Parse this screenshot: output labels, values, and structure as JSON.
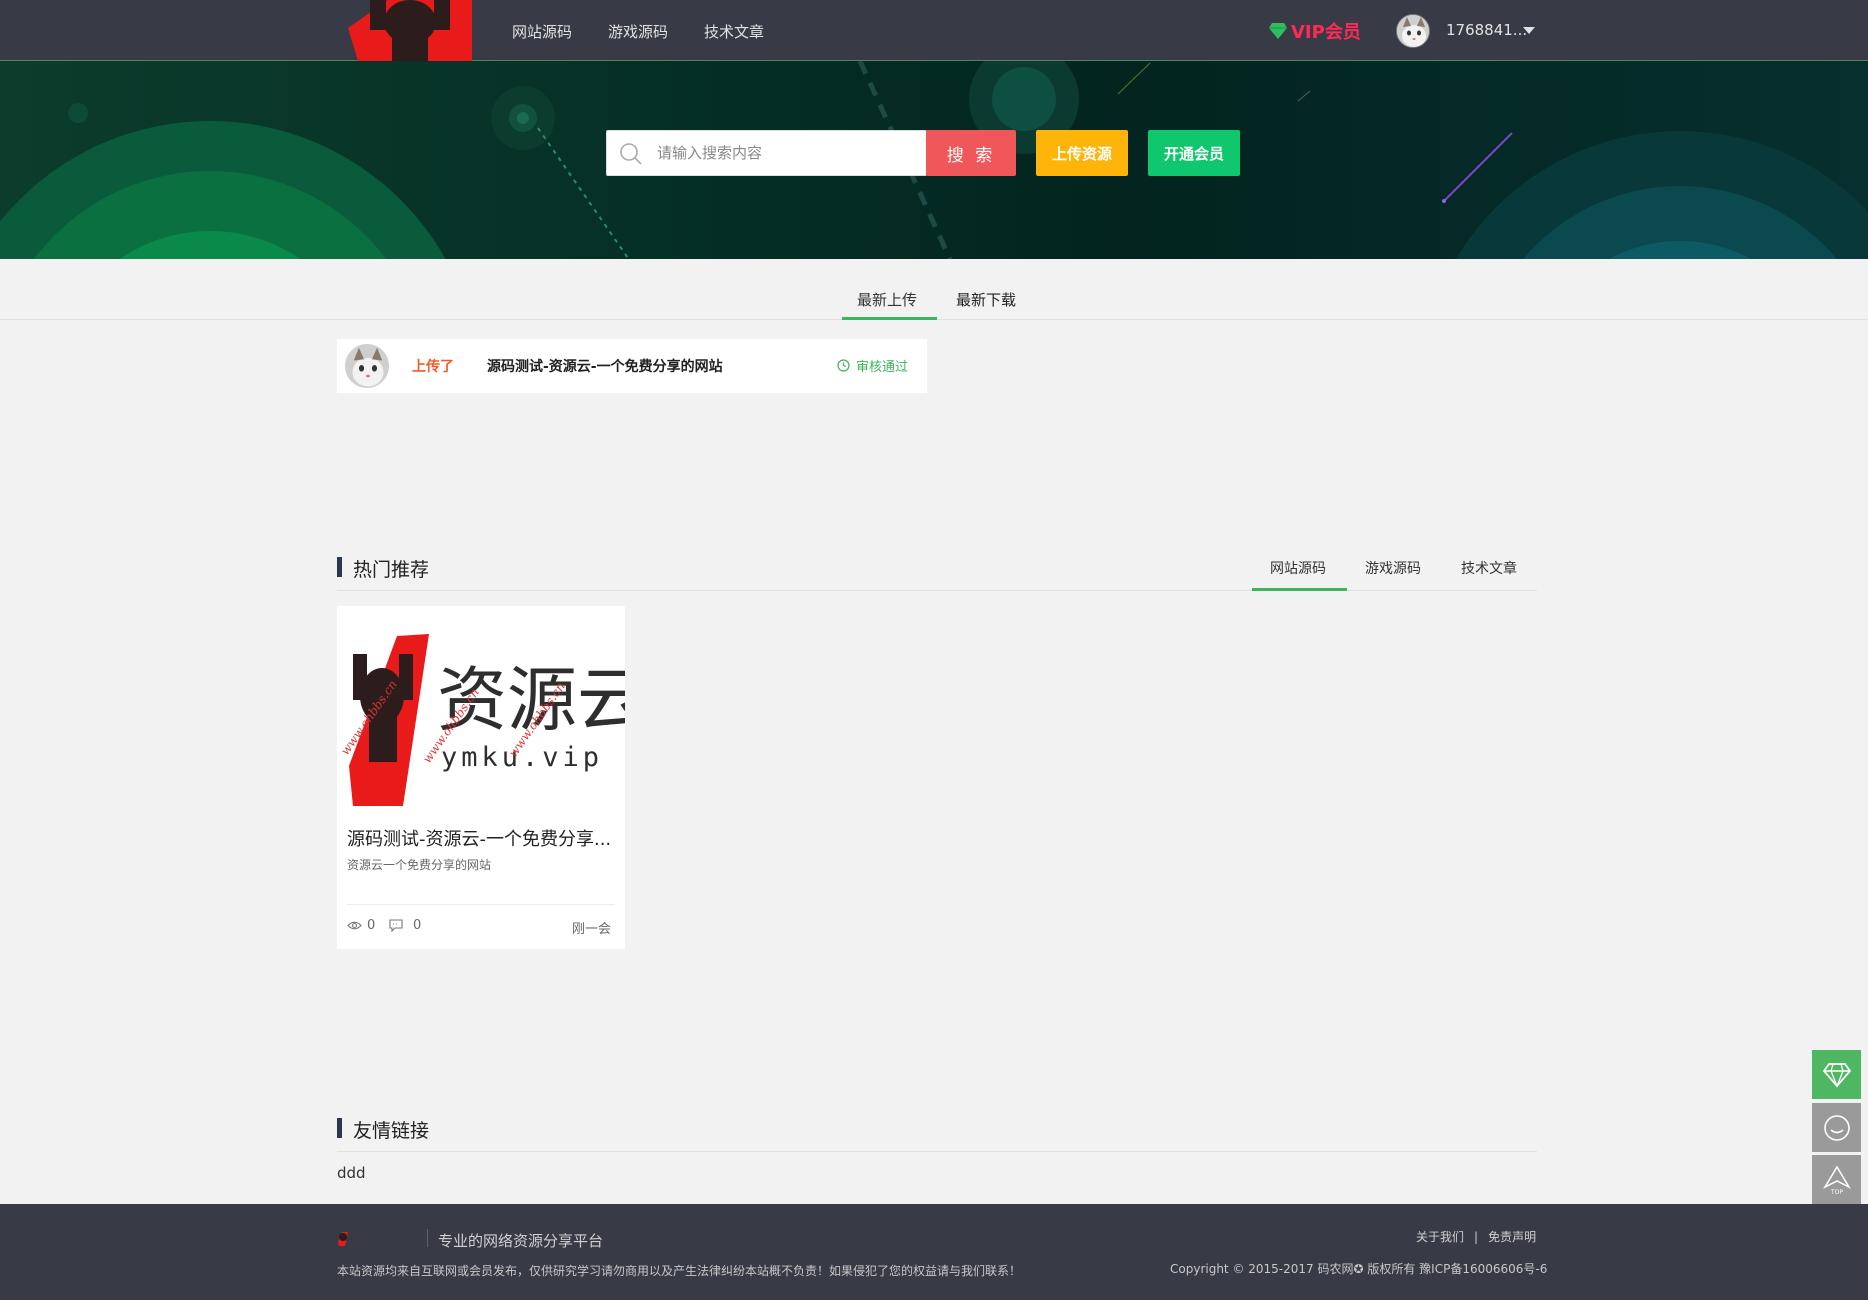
{
  "nav": {
    "items": [
      {
        "label": "网站源码"
      },
      {
        "label": "游戏源码"
      },
      {
        "label": "技术文章"
      }
    ],
    "vip_label": "VIP会员",
    "username": "1768841..."
  },
  "search": {
    "placeholder": "请输入搜索内容",
    "button_label": "搜 索",
    "upload_label": "上传资源",
    "open_vip_label": "开通会员"
  },
  "latest": {
    "tabs": [
      {
        "label": "最新上传",
        "active": true
      },
      {
        "label": "最新下载",
        "active": false
      }
    ],
    "items": [
      {
        "verb": "上传了",
        "title": "源码测试-资源云-一个免费分享的网站",
        "status": "审核通过"
      }
    ]
  },
  "hot": {
    "title": "热门推荐",
    "tabs": [
      {
        "label": "网站源码",
        "active": true
      },
      {
        "label": "游戏源码",
        "active": false
      },
      {
        "label": "技术文章",
        "active": false
      }
    ],
    "items": [
      {
        "thumb_text": "资源云",
        "thumb_domain": "ymku.vip",
        "thumb_watermark": "www.ohbbs.cn",
        "title": "源码测试-资源云-一个免费分享...",
        "desc": "资源云一个免费分享的网站",
        "views": "0",
        "comments": "0",
        "time": "刚一会"
      }
    ]
  },
  "links": {
    "title": "友情链接",
    "items": [
      "ddd"
    ]
  },
  "footer": {
    "slogan": "专业的网络资源分享平台",
    "notice": "本站资源均来自互联网或会员发布，仅供研究学习请勿商用以及产生法律纠纷本站概不负责！如果侵犯了您的权益请与我们联系！",
    "about": "关于我们",
    "disclaimer": "免责声明",
    "copyright": "Copyright © 2015-2017 码农网✪ 版权所有 豫ICP备16006606号-6"
  },
  "colors": {
    "topbar": "#383a45",
    "accent_green": "#3db55a",
    "search_red": "#f0575a",
    "upload_yellow": "#ffb40a",
    "vip_green": "#0fc76d",
    "vip_pink": "#ff2a55"
  },
  "icons": [
    "logo-icon",
    "diamond-icon",
    "caret-down-icon",
    "search-icon",
    "clock-icon",
    "eye-icon",
    "comment-icon",
    "chat-icon",
    "top-arrow-icon"
  ]
}
